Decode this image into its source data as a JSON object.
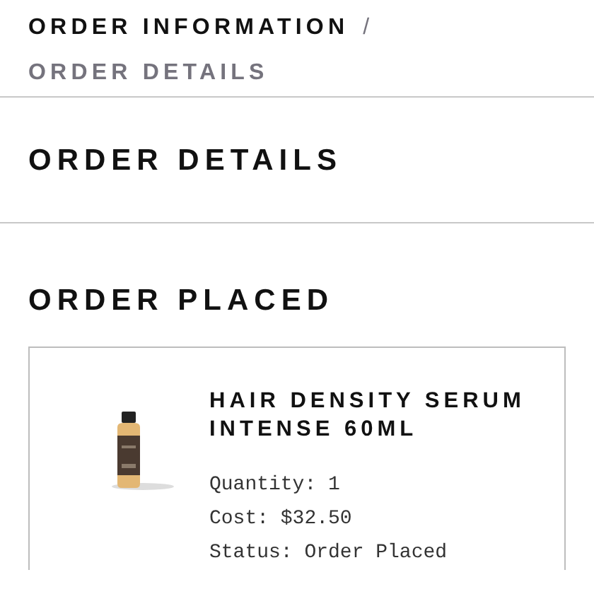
{
  "breadcrumb": [
    {
      "label": "ORDER INFORMATION",
      "selected": false
    },
    {
      "label": "ORDER DETAILS",
      "selected": true
    }
  ],
  "breadcrumb_separator": "/",
  "page_title": "ORDER DETAILS",
  "section_title": "ORDER PLACED",
  "order_items": [
    {
      "name": "HAIR DENSITY SERUM INTENSE 60ML",
      "details": [
        "Quantity: 1",
        "Cost: $32.50",
        "Status: Order Placed"
      ]
    }
  ]
}
